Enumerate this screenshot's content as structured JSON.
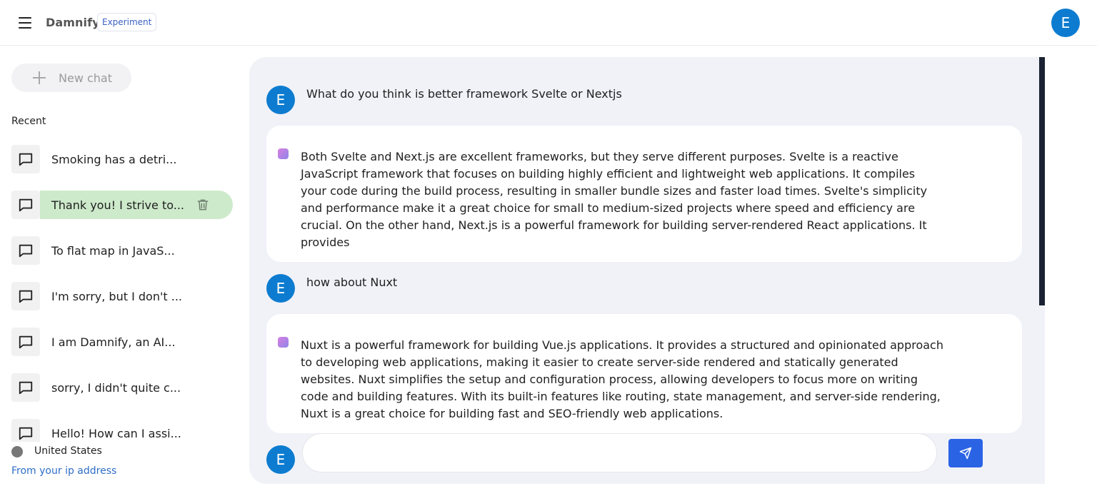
{
  "header": {
    "brand": "Damnify",
    "badge": "Experiment",
    "avatar_letter": "E"
  },
  "sidebar": {
    "new_chat_label": "New chat",
    "recent_label": "Recent",
    "items": [
      {
        "label": "Smoking has a detri..."
      },
      {
        "label": "Thank you! I strive to...",
        "active": true
      },
      {
        "label": "To flat map in JavaS..."
      },
      {
        "label": "I'm sorry, but I don't ..."
      },
      {
        "label": "I am Damnify, an AI..."
      },
      {
        "label": "sorry, I didn't quite c..."
      },
      {
        "label": "Hello! How can I assi..."
      }
    ],
    "country": "United States",
    "ip_link": "From your ip address"
  },
  "chat": {
    "messages": [
      {
        "role": "user",
        "avatar": "E",
        "text": "What do you think is better framework Svelte or Nextjs"
      },
      {
        "role": "assistant",
        "text": "Both Svelte and Next.js are excellent frameworks, but they serve different purposes. Svelte is a reactive JavaScript framework that focuses on building highly efficient and lightweight web applications. It compiles your code during the build process, resulting in smaller bundle sizes and faster load times. Svelte's simplicity and performance make it a great choice for small to medium-sized projects where speed and efficiency are crucial. On the other hand, Next.js is a powerful framework for building server-rendered React applications. It provides"
      },
      {
        "role": "user",
        "avatar": "E",
        "text": "how about Nuxt"
      },
      {
        "role": "assistant",
        "text": "Nuxt is a powerful framework for building Vue.js applications. It provides a structured and opinionated approach to developing web applications, making it easier to create server-side rendered and statically generated websites. Nuxt simplifies the setup and configuration process, allowing developers to focus more on writing code and building features. With its built-in features like routing, state management, and server-side rendering, Nuxt is a great choice for building fast and SEO-friendly web applications."
      }
    ],
    "input": {
      "avatar": "E",
      "value": "",
      "placeholder": ""
    }
  },
  "colors": {
    "accent": "#2b63e5",
    "avatar": "#0d7cd0",
    "active_item": "#cdeacb",
    "chat_bg": "#f1f2f8"
  },
  "icons": {
    "menu": "menu-icon",
    "plus": "plus-icon",
    "chat": "chat-bubble-icon",
    "trash": "trash-icon",
    "send": "send-icon"
  }
}
